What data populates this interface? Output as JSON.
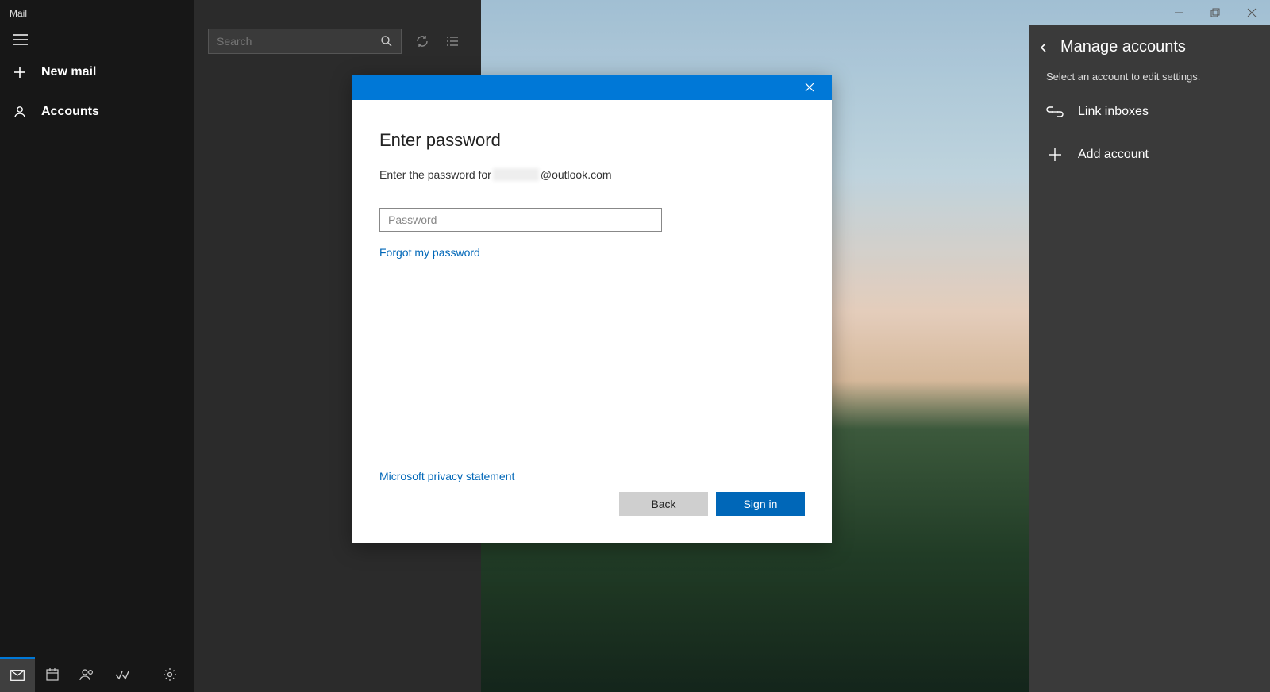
{
  "app_title": "Mail",
  "sidebar": {
    "new_mail": "New mail",
    "accounts": "Accounts"
  },
  "search": {
    "placeholder": "Search"
  },
  "window_controls": {
    "minimize": "Minimize",
    "maximize": "Restore",
    "close": "Close"
  },
  "right_panel": {
    "title": "Manage accounts",
    "subtitle": "Select an account to edit settings.",
    "link_inboxes": "Link inboxes",
    "add_account": "Add account"
  },
  "dialog": {
    "heading": "Enter password",
    "prompt_prefix": "Enter the password for ",
    "prompt_suffix": "@outlook.com",
    "password_placeholder": "Password",
    "forgot_link": "Forgot my password",
    "privacy_link": "Microsoft privacy statement",
    "back": "Back",
    "signin": "Sign in"
  },
  "bottom_icons": {
    "mail": "Mail",
    "calendar": "Calendar",
    "people": "People",
    "todo": "To Do",
    "settings": "Settings"
  }
}
